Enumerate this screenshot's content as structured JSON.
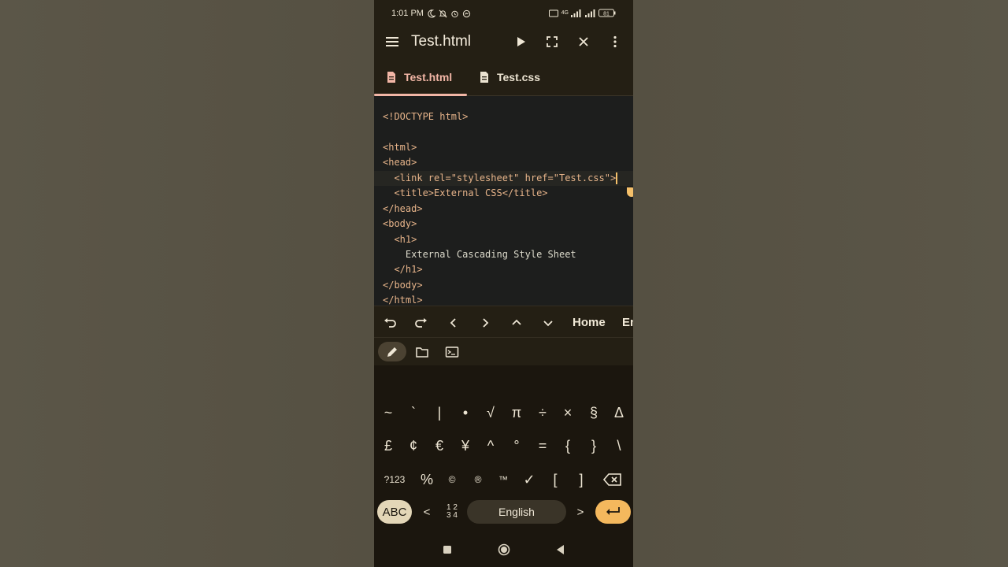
{
  "status_bar": {
    "time": "1:01 PM",
    "network": "4G",
    "battery": "81"
  },
  "app_bar": {
    "title": "Test.html"
  },
  "tabs": [
    {
      "label": "Test.html",
      "active": true
    },
    {
      "label": "Test.css",
      "active": false
    }
  ],
  "editor": {
    "lines": [
      "<!DOCTYPE html>",
      "",
      "<html>",
      "<head>",
      "  <link rel=\"stylesheet\" href=\"Test.css\">",
      "  <title>External CSS</title>",
      "</head>",
      "<body>",
      "  <h1>",
      "    External Cascading Style Sheet",
      "  </h1>",
      "</body>",
      "</html>"
    ]
  },
  "toolbar": {
    "home_label": "Home",
    "end_label": "En"
  },
  "keyboard": {
    "row1": [
      "~",
      "`",
      "|",
      "•",
      "√",
      "π",
      "÷",
      "×",
      "§",
      "Δ"
    ],
    "row2": [
      "£",
      "¢",
      "€",
      "¥",
      "^",
      "°",
      "=",
      "{",
      "}",
      "\\"
    ],
    "row3": [
      "?123",
      "%",
      "©",
      "®",
      "™",
      "✓",
      "[",
      "]"
    ],
    "abc_label": "ABC",
    "numpad_label_top": "1 2",
    "numpad_label_bottom": "3 4",
    "space_label": "English",
    "lt": "<",
    "gt": ">"
  },
  "colors": {
    "accent": "#f2b6a6",
    "enter_key": "#f4b85d",
    "cursor": "#f5c06a",
    "background": "#1b160e"
  }
}
